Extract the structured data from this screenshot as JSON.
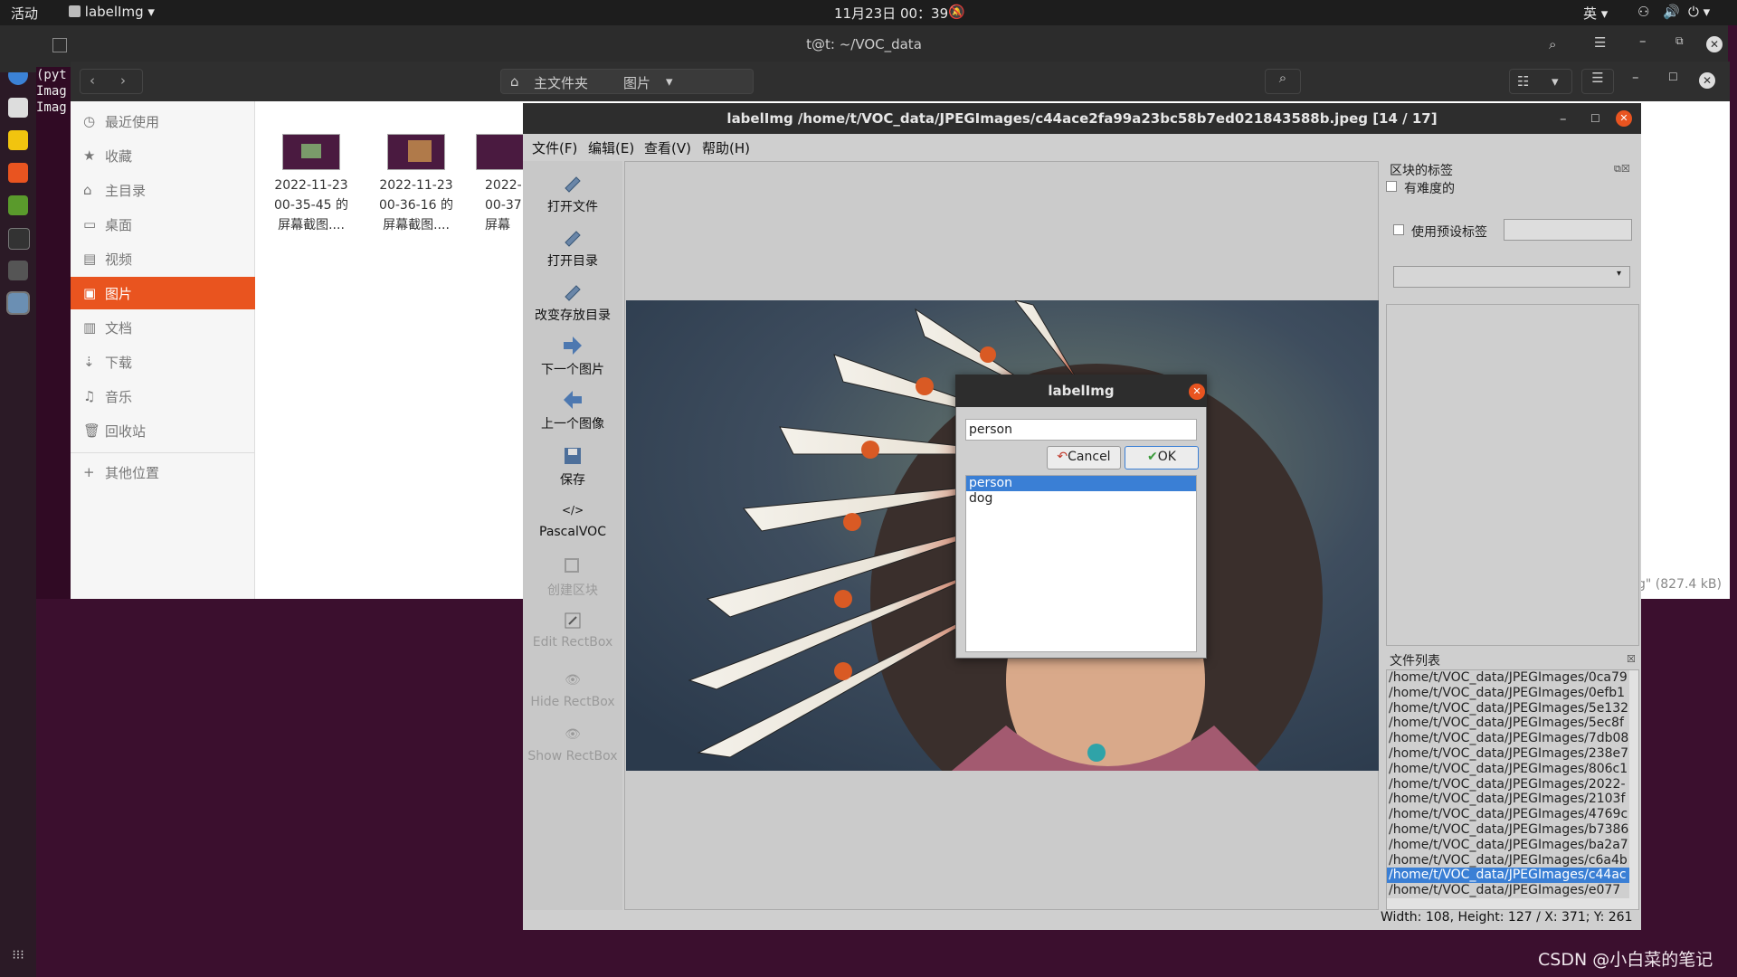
{
  "topbar": {
    "activities": "活动",
    "app_name": "labelImg",
    "clock": "11月23日  00：39",
    "input_method": "英"
  },
  "terminal": {
    "title": "t@t: ~/VOC_data",
    "lines": [
      "(pyt",
      "Imag",
      "Imag"
    ]
  },
  "files": {
    "path": {
      "home": "主文件夹",
      "current": "图片"
    },
    "sidebar": [
      {
        "label": "最近使用",
        "icon": "clock-icon"
      },
      {
        "label": "收藏",
        "icon": "star-icon"
      },
      {
        "label": "主目录",
        "icon": "home-icon"
      },
      {
        "label": "桌面",
        "icon": "desktop-icon"
      },
      {
        "label": "视频",
        "icon": "video-icon"
      },
      {
        "label": "图片",
        "icon": "image-icon",
        "active": true
      },
      {
        "label": "文档",
        "icon": "document-icon"
      },
      {
        "label": "下载",
        "icon": "download-icon"
      },
      {
        "label": "音乐",
        "icon": "music-icon"
      },
      {
        "label": "回收站",
        "icon": "trash-icon"
      },
      {
        "label": "其他位置",
        "icon": "plus-icon"
      }
    ],
    "thumbs": [
      {
        "line1": "2022-11-23",
        "line2": "00-35-45 的",
        "line3": "屏幕截图...."
      },
      {
        "line1": "2022-11-23",
        "line2": "00-36-16 的",
        "line3": "屏幕截图...."
      },
      {
        "line1": "2022-",
        "line2": "00-37",
        "line3": "屏幕"
      }
    ],
    "status_size": "g\" (827.4 kB)"
  },
  "labelimg": {
    "title": "labelImg /home/t/VOC_data/JPEGImages/c44ace2fa99a23bc58b7ed021843588b.jpeg [14 / 17]",
    "menus": [
      "文件(F)",
      "编辑(E)",
      "查看(V)",
      "帮助(H)"
    ],
    "tools": [
      {
        "label": "打开文件",
        "icon": "open-file-icon",
        "enabled": true
      },
      {
        "label": "打开目录",
        "icon": "open-dir-icon",
        "enabled": true
      },
      {
        "label": "改变存放目录",
        "icon": "change-dir-icon",
        "enabled": true
      },
      {
        "label": "下一个图片",
        "icon": "arrow-right-icon",
        "enabled": true
      },
      {
        "label": "上一个图像",
        "icon": "arrow-left-icon",
        "enabled": true
      },
      {
        "label": "保存",
        "icon": "save-icon",
        "enabled": true
      },
      {
        "label": "PascalVOC",
        "icon": "code-icon",
        "enabled": true
      },
      {
        "label": "创建区块",
        "icon": "create-rect-icon",
        "enabled": false
      },
      {
        "label": "Edit RectBox",
        "icon": "edit-icon",
        "enabled": false
      },
      {
        "label": "Hide RectBox",
        "icon": "eye-icon",
        "enabled": false
      },
      {
        "label": "Show RectBox",
        "icon": "eye-icon",
        "enabled": false
      }
    ],
    "box_labels": {
      "title": "区块的标签",
      "difficult": "有难度的",
      "use_default": "使用预设标签"
    },
    "file_list": {
      "title": "文件列表",
      "items": [
        "/home/t/VOC_data/JPEGImages/0ca79",
        "/home/t/VOC_data/JPEGImages/0efb1",
        "/home/t/VOC_data/JPEGImages/5e132",
        "/home/t/VOC_data/JPEGImages/5ec8f",
        "/home/t/VOC_data/JPEGImages/7db08",
        "/home/t/VOC_data/JPEGImages/238e7",
        "/home/t/VOC_data/JPEGImages/806c1",
        "/home/t/VOC_data/JPEGImages/2022-",
        "/home/t/VOC_data/JPEGImages/2103f",
        "/home/t/VOC_data/JPEGImages/4769c",
        "/home/t/VOC_data/JPEGImages/b7386",
        "/home/t/VOC_data/JPEGImages/ba2a7",
        "/home/t/VOC_data/JPEGImages/c6a4b",
        "/home/t/VOC_data/JPEGImages/c44ac",
        "/home/t/VOC_data/JPEGImages/e077"
      ],
      "selected_index": 13
    },
    "status": "Width: 108, Height: 127 / X: 371; Y: 261"
  },
  "dialog": {
    "title": "labelImg",
    "input_value": "person",
    "cancel_label": "Cancel",
    "ok_label": "OK",
    "options": [
      "person",
      "dog"
    ],
    "selected_option": 0
  },
  "watermark": "CSDN @小白菜的笔记",
  "colors": {
    "accent": "#e9541f",
    "selection": "#3a7fd5"
  }
}
